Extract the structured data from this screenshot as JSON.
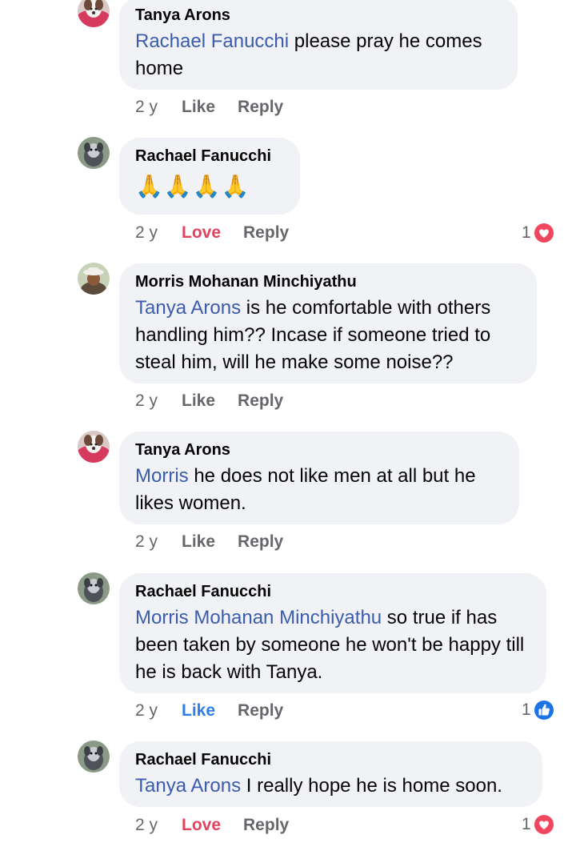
{
  "colors": {
    "bubble_bg": "#f0f2f5",
    "mention": "#3b5cad",
    "meta": "#65676b",
    "love": "#e0445e",
    "like": "#2d7ee5"
  },
  "comments": [
    {
      "author": "Tanya Arons",
      "mention": "Rachael Fanucchi",
      "text": " please pray he comes home",
      "time": "2 y",
      "react_label": "Like",
      "reply_label": "Reply"
    },
    {
      "author": "Rachael Fanucchi",
      "emoji": "🙏🙏🙏🙏",
      "emoji_icon": "folded-hands-icon",
      "time": "2 y",
      "react_label": "Love",
      "reply_label": "Reply",
      "reaction_count": "1",
      "reaction_icon": "love-heart-icon"
    },
    {
      "author": "Morris Mohanan Minchiyathu",
      "mention": "Tanya Arons",
      "text": " is he comfortable with others handling him?? Incase if someone tried to steal him, will he make some noise??",
      "time": "2 y",
      "react_label": "Like",
      "reply_label": "Reply"
    },
    {
      "author": "Tanya Arons",
      "mention": "Morris",
      "text": " he does not like men at all but he likes women.",
      "time": "2 y",
      "react_label": "Like",
      "reply_label": "Reply"
    },
    {
      "author": "Rachael Fanucchi",
      "mention": "Morris Mohanan Minchiyathu",
      "text": " so true if has been taken by someone he won't be happy till he is back with Tanya.",
      "time": "2 y",
      "react_label": "Like",
      "reply_label": "Reply",
      "reaction_count": "1",
      "reaction_icon": "like-thumb-icon"
    },
    {
      "author": "Rachael Fanucchi",
      "mention": "Tanya Arons",
      "text": " I really hope he is home soon.",
      "time": "2 y",
      "react_label": "Love",
      "reply_label": "Reply",
      "reaction_count": "1",
      "reaction_icon": "love-heart-icon"
    }
  ]
}
